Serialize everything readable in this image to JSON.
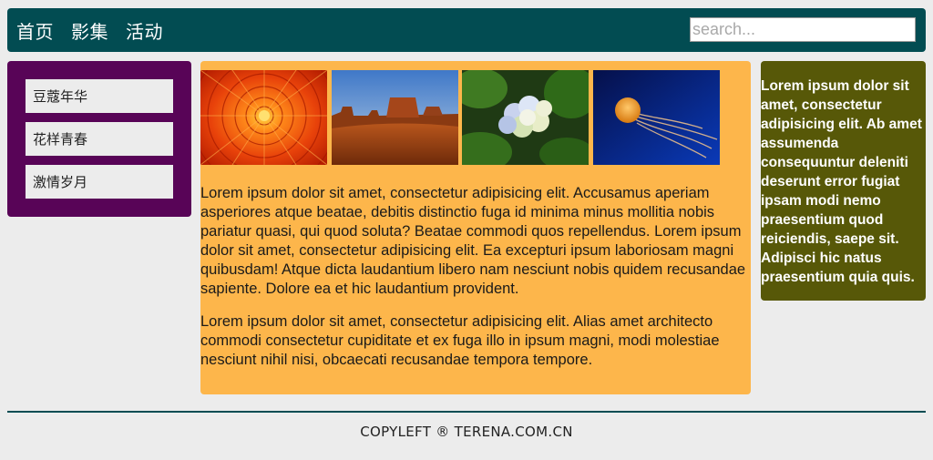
{
  "header": {
    "nav": [
      "首页",
      "影集",
      "活动"
    ],
    "search_placeholder": "search..."
  },
  "sidebar": {
    "items": [
      "豆蔻年华",
      "花样青春",
      "激情岁月"
    ]
  },
  "gallery": {
    "images": [
      "chrysanthemum-photo",
      "desert-photo",
      "hydrangea-photo",
      "jellyfish-photo"
    ]
  },
  "main": {
    "paragraphs": [
      "Lorem ipsum dolor sit amet, consectetur adipisicing elit. Accusamus aperiam asperiores atque beatae, debitis distinctio fuga id minima minus mollitia nobis pariatur quasi, qui quod soluta? Beatae commodi quos repellendus. Lorem ipsum dolor sit amet, consectetur adipisicing elit. Ea excepturi ipsum laboriosam magni quibusdam! Atque dicta laudantium libero nam nesciunt nobis quidem recusandae sapiente. Dolore ea et hic laudantium provident.",
      "Lorem ipsum dolor sit amet, consectetur adipisicing elit. Alias amet architecto commodi consectetur cupiditate et ex fuga illo in ipsum magni, modi molestiae nesciunt nihil nisi, obcaecati recusandae tempora tempore."
    ]
  },
  "aside": {
    "text": "Lorem ipsum dolor sit amet, consectetur adipisicing elit. Ab amet assumenda consequuntur deleniti deserunt error fugiat ipsam modi nemo praesentium quod reiciendis, saepe sit. Adipisci hic natus praesentium quia quis."
  },
  "footer": {
    "text": "COPYLEFT ® TERENA.COM.CN"
  },
  "colors": {
    "header": "#024c52",
    "sidebar": "#580457",
    "main": "#fdb64b",
    "aside": "#575808",
    "background": "#ececec"
  }
}
